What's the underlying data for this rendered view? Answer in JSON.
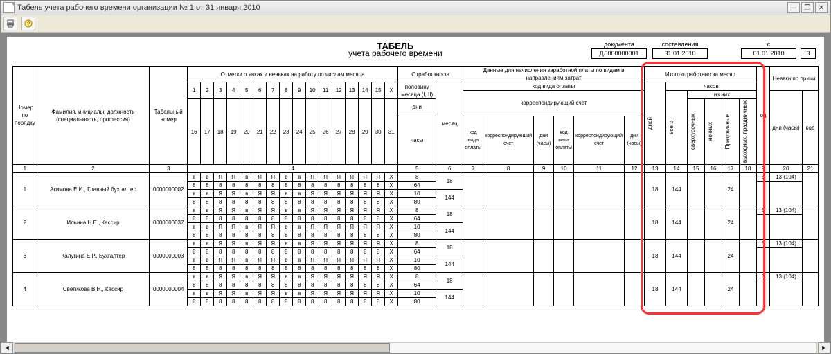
{
  "window": {
    "title": "Табель учета рабочего времени организации № 1 от 31 января 2010"
  },
  "toolbar": {
    "print_icon": "printer-icon",
    "help_icon": "help-icon"
  },
  "doc_meta": {
    "label_document": "документа",
    "label_composed": "составления",
    "label_from": "с",
    "doc_number": "ДЛ000000001",
    "compose_date": "31.01.2010",
    "from_date": "01.01.2010",
    "to_partial": "3"
  },
  "title": {
    "line1": "ТАБЕЛЬ",
    "line2": "учета  рабочего времени"
  },
  "headers": {
    "num": "Номер по порядку",
    "fio": "Фамилия, инициалы, должность (специальность, профессия)",
    "tabnum": "Табельный номер",
    "marks": "Отметки о явках и неявках на работу по числам месяца",
    "worked": "Отработано за",
    "halfmonth": "половину месяца (I, II)",
    "month": "месяц",
    "days": "дни",
    "hours": "часы",
    "payroll": "Данные для начисления заработной платы по видам и направлениям затрат",
    "pay_code_label": "код вида оплаты",
    "corr_account": "корреспондирующий счет",
    "c_code_pay": "код вида оплаты",
    "c_corresp": "корреспондирующий счет",
    "c_dh": "дни (часы)",
    "total": "Итого отработано за месяц",
    "total_hours": "часов",
    "total_of_them": "из них",
    "col_days": "дней",
    "col_total": "всего",
    "col_overtime": "сверхурочных",
    "col_night": "ночных",
    "col_holiday": "Праздничные",
    "col_weekend": "выходных, праздничных",
    "absence": "Неявки по причи",
    "col_code": "од",
    "col_days_hours": "дни (часы)",
    "col_code2": "код"
  },
  "daynums_top": [
    "1",
    "2",
    "3",
    "4",
    "5",
    "6",
    "7",
    "8",
    "9",
    "10",
    "11",
    "12",
    "13",
    "14",
    "15",
    "Х"
  ],
  "daynums_bot": [
    "16",
    "17",
    "18",
    "19",
    "20",
    "21",
    "22",
    "23",
    "24",
    "25",
    "26",
    "27",
    "28",
    "29",
    "30",
    "31"
  ],
  "colnums": {
    "c1": "1",
    "c2": "2",
    "c3": "3",
    "c4": "4",
    "c5": "5",
    "c6": "6",
    "c7": "7",
    "c8": "8",
    "c9": "9",
    "c10": "10",
    "c11": "11",
    "c12": "12",
    "c13": "13",
    "c14": "14",
    "c15": "15",
    "c16": "16",
    "c17": "17",
    "c18": "18",
    "c19": "9",
    "c20": "20",
    "c21": "21"
  },
  "pattern_top": [
    "в",
    "в",
    "Я",
    "Я",
    "в",
    "Я",
    "Я",
    "в",
    "в",
    "Я",
    "Я",
    "Я",
    "Я",
    "Я",
    "Я",
    "Х"
  ],
  "pattern_8": [
    "8",
    "8",
    "8",
    "8",
    "8",
    "8",
    "8",
    "8",
    "8",
    "8",
    "8",
    "8",
    "8",
    "8",
    "8",
    "Х"
  ],
  "pattern_bot": [
    "в",
    "в",
    "Я",
    "Я",
    "в",
    "Я",
    "Я",
    "в",
    "в",
    "Я",
    "Я",
    "Я",
    "Я",
    "Я",
    "Я",
    "Х"
  ],
  "employees": [
    {
      "num": "1",
      "fio": "Акимова Е.И., Главный бухгалтер",
      "tab": "0000000002",
      "half_days": "8",
      "half_hours": "64",
      "m_days": "10",
      "m_hours": "80",
      "month_days": "18",
      "month_hours": "144",
      "tot_days": "18",
      "tot_all": "144",
      "tot_holiday": "24",
      "abs_code": "В",
      "abs_dh": "13 (104)"
    },
    {
      "num": "2",
      "fio": "Ильина Н.Е., Кассир",
      "tab": "0000000037",
      "half_days": "8",
      "half_hours": "64",
      "m_days": "10",
      "m_hours": "80",
      "month_days": "18",
      "month_hours": "144",
      "tot_days": "18",
      "tot_all": "144",
      "tot_holiday": "24",
      "abs_code": "В",
      "abs_dh": "13 (104)"
    },
    {
      "num": "3",
      "fio": "Калугина Е.Р., Бухгалтер",
      "tab": "0000000003",
      "half_days": "8",
      "half_hours": "64",
      "m_days": "10",
      "m_hours": "80",
      "month_days": "18",
      "month_hours": "144",
      "tot_days": "18",
      "tot_all": "144",
      "tot_holiday": "24",
      "abs_code": "В",
      "abs_dh": "13 (104)"
    },
    {
      "num": "4",
      "fio": "Светикова В.Н., Кассир",
      "tab": "0000000004",
      "half_days": "8",
      "half_hours": "64",
      "m_days": "10",
      "m_hours": "80",
      "month_days": "18",
      "month_hours": "144",
      "tot_days": "18",
      "tot_all": "144",
      "tot_holiday": "24",
      "abs_code": "В",
      "abs_dh": "13 (104)"
    }
  ]
}
